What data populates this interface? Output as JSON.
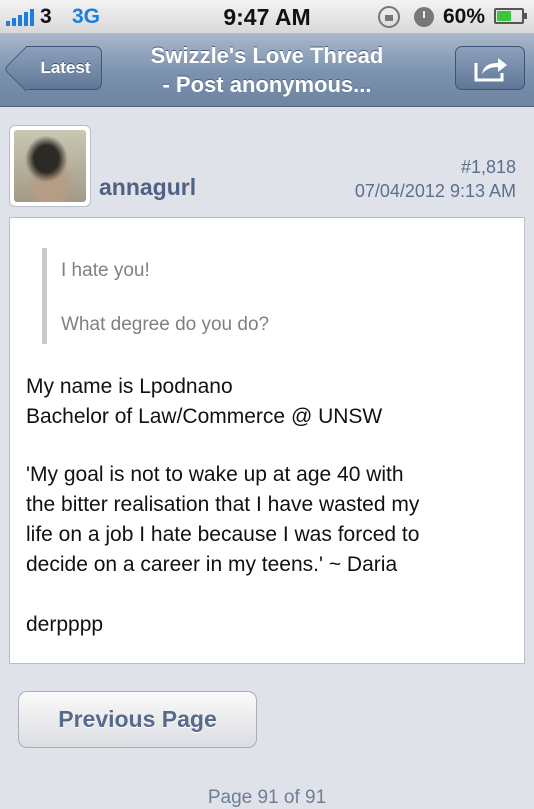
{
  "status_bar": {
    "carrier": "3",
    "network": "3G",
    "time": "9:47 AM",
    "battery_percent": "60%",
    "battery_level": 0.6,
    "icons": [
      "signal-icon",
      "orientation-lock-icon",
      "alarm-icon",
      "battery-icon"
    ]
  },
  "nav": {
    "back_label": "Latest",
    "title_line1": "Swizzle's Love Thread",
    "title_line2": "- Post anonymous...",
    "share_icon": "share-icon"
  },
  "post": {
    "username": "annagurl",
    "number": "#1,818",
    "date": "07/04/2012 9:13 AM",
    "quote": [
      "I hate you!",
      "What degree do you do?"
    ],
    "lines": [
      "My name is Lpodnano",
      "Bachelor of Law/Commerce @ UNSW",
      "'My goal is not to wake up at age 40 with",
      "the bitter realisation that I have wasted my",
      "life on a job I hate because I was forced to",
      "decide on a career in my teens.' ~ Daria",
      "derpppp"
    ]
  },
  "footer": {
    "prev_button": "Previous Page",
    "page_indicator": "Page 91 of 91"
  },
  "colors": {
    "nav_bar": "#7b91ad",
    "username": "#4f6283",
    "meta_text": "#5d6f8f",
    "background": "#dfe2e8"
  }
}
